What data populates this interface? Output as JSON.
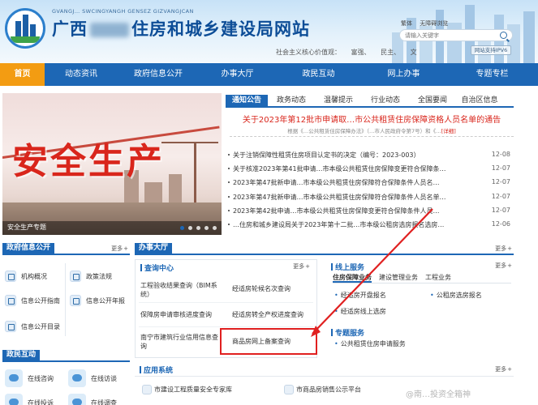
{
  "header": {
    "pinyin": "GVANGJ… SWCINGYANGH GENSEZ GIZVANGJCAN",
    "title_prefix": "广西",
    "title_suffix": "住房和城乡建设局网站",
    "motto_prefix": "社会主义核心价值观：",
    "motto_values": [
      "富强、",
      "民主、",
      "文"
    ],
    "lang_links": [
      "繁体",
      "无障碍浏览"
    ],
    "search_placeholder": "请输入关键字",
    "ipv6_label": "网站支持IPV6"
  },
  "nav": {
    "items": [
      {
        "label": "首页",
        "active": true
      },
      {
        "label": "动态资讯",
        "active": false
      },
      {
        "label": "政府信息公开",
        "active": false
      },
      {
        "label": "办事大厅",
        "active": false
      },
      {
        "label": "政民互动",
        "active": false
      },
      {
        "label": "网上办事",
        "active": false
      },
      {
        "label": "专题专栏",
        "active": false
      }
    ]
  },
  "banner": {
    "headline": "安全生产",
    "caption": "安全生产专题",
    "slide_count": 5,
    "active_slide": 0
  },
  "news": {
    "tabs": [
      {
        "label": "通知公告",
        "active": true
      },
      {
        "label": "政务动态",
        "active": false
      },
      {
        "label": "温馨提示",
        "active": false
      },
      {
        "label": "行业动态",
        "active": false
      },
      {
        "label": "全国要闻",
        "active": false
      },
      {
        "label": "自治区信息",
        "active": false
      }
    ],
    "headline": "关于2023年第12批市申请取…市公共租赁住房保障资格人员名单的通告",
    "headline_sub": "根据《…公共租赁住房保障办法》（…市人民政府令第7号）和《…",
    "headline_detail": "[详细]",
    "items": [
      {
        "title": "关于注销保障性租赁住房项目认定书的决定（编号：2023-003）",
        "date": "12-08"
      },
      {
        "title": "关于核准2023年第41批申请…市本级公共租赁住房保障变更符合保障条…",
        "date": "12-07"
      },
      {
        "title": "2023年第47批新申请…市本级公共租赁住房保障符合保障条件人员名…",
        "date": "12-07"
      },
      {
        "title": "2023年第47批新申请…市本级公共租赁住房保障符合保障条件人员名单…",
        "date": "12-07"
      },
      {
        "title": "2023年第42批申请…市本级公共租赁住房保障变更符合保障条件人员…",
        "date": "12-07"
      },
      {
        "title": "…住房和城乡建设局关于2023年第十二批…市本级公租房选房报名选房…",
        "date": "12-06"
      }
    ]
  },
  "gov_open": {
    "title": "政府信息公开",
    "more": "更多",
    "items": [
      "机构概况",
      "政策法规",
      "信息公开指南",
      "信息公开年报",
      "信息公开目录"
    ]
  },
  "interaction": {
    "title": "政民互动",
    "items": [
      "在线咨询",
      "在线访谈",
      "在线投诉",
      "在线调查"
    ]
  },
  "services": {
    "title": "办事大厅",
    "more": "更多",
    "query": {
      "title": "查询中心",
      "more": "更多",
      "items": [
        "工程验收结果查询（BIM系统）",
        "经适房轮候名次查询",
        "保障房申请审核进度查询",
        "经适房转全产权进度查询",
        "南宁市建筑行业信用信息查询",
        "商品房网上备案查询"
      ]
    },
    "online": {
      "title": "线上服务",
      "more": "更多",
      "tabs": [
        {
          "label": "住房保障业务",
          "active": true
        },
        {
          "label": "建设管理业务",
          "active": false
        },
        {
          "label": "工程业务",
          "active": false
        }
      ],
      "links": [
        "经适房开盘报名",
        "公租房选房报名",
        "经适房线上选房"
      ]
    },
    "special": {
      "title": "专题服务",
      "links": [
        "公共租赁住房申请服务"
      ]
    }
  },
  "apps": {
    "title": "应用系统",
    "more": "更多",
    "items": [
      "市建设工程质量安全专家库",
      "市商品房销售公示平台"
    ]
  },
  "watermark": "@南…投资全箱神"
}
